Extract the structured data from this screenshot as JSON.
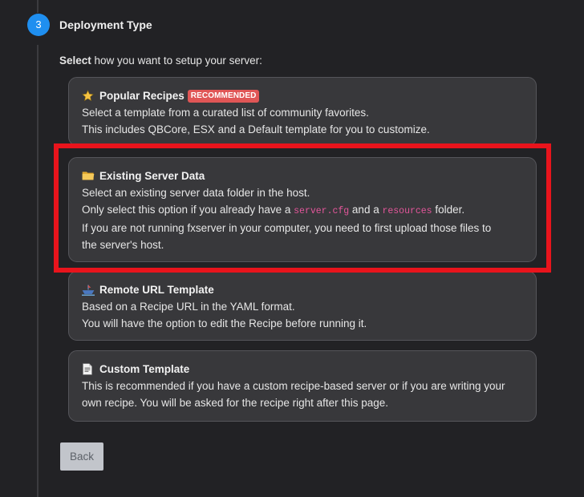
{
  "step": {
    "number": "3",
    "title": "Deployment Type"
  },
  "intro": {
    "bold": "Select",
    "rest": " how you want to setup your server:"
  },
  "options": [
    {
      "title": "Popular Recipes",
      "badge": "RECOMMENDED",
      "icon": "star-icon",
      "lines": [
        "Select a template from a curated list of community favorites.",
        "This includes QBCore, ESX and a Default template for you to customize."
      ]
    },
    {
      "title": "Existing Server Data",
      "icon": "folder-icon",
      "line1": "Select an existing server data folder in the host.",
      "line2_a": "Only select this option if you already have a ",
      "line2_code1": "server.cfg",
      "line2_b": " and a ",
      "line2_code2": "resources",
      "line2_c": " folder.",
      "line3": "If you are not running fxserver in your computer, you need to first upload those files to",
      "line4": "the server's host."
    },
    {
      "title": "Remote URL Template",
      "icon": "boat-icon",
      "lines": [
        "Based on a Recipe URL in the YAML format.",
        "You will have the option to edit the Recipe before running it."
      ]
    },
    {
      "title": "Custom Template",
      "icon": "doc-icon",
      "lines": [
        "This is recommended if you have a custom recipe-based server or if you are writing your",
        "own recipe. You will be asked for the recipe right after this page."
      ]
    }
  ],
  "back_label": "Back",
  "colors": {
    "accent": "#1f8ff0",
    "badge": "#e05656",
    "highlight": "#e8141c",
    "code": "#e4569b"
  }
}
